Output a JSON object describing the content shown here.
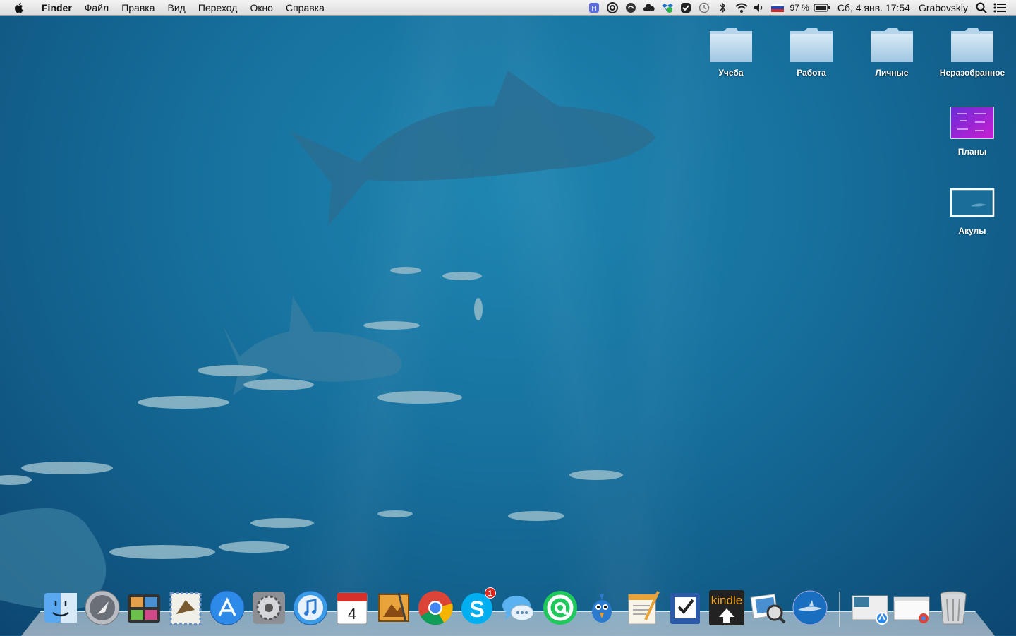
{
  "menubar": {
    "apple_icon": "apple-icon",
    "items": [
      "Finder",
      "Файл",
      "Правка",
      "Вид",
      "Переход",
      "Окно",
      "Справка"
    ],
    "status": {
      "battery_percent": "97 %",
      "datetime": "Сб, 4 янв.  17:54",
      "user": "Grabovskiy"
    }
  },
  "desktop": {
    "icons": [
      {
        "label": "Учеба",
        "icon": "folder-icon"
      },
      {
        "label": "Работа",
        "icon": "folder-icon"
      },
      {
        "label": "Личные",
        "icon": "folder-icon"
      },
      {
        "label": "Неразобранное",
        "icon": "folder-icon"
      },
      {
        "label": "Планы",
        "icon": "image-file-icon"
      },
      {
        "label": "Акулы",
        "icon": "image-file-icon"
      }
    ]
  },
  "dock": {
    "apps": [
      "finder-icon",
      "launchpad-icon",
      "photo-booth-icon",
      "mail-icon",
      "app-store-icon",
      "system-preferences-icon",
      "itunes-icon",
      "calendar-icon",
      "iphoto-icon",
      "chrome-icon",
      "skype-icon",
      "messages-icon",
      "mail-agent-icon",
      "twitterrific-icon",
      "pages-icon",
      "things-icon",
      "kindle-icon",
      "preview-icon",
      "shark-icon"
    ],
    "calendar_day": "4",
    "kindle_label": "kindle",
    "skype_badge": "1",
    "right": [
      "downloads-stack-icon",
      "documents-stack-icon",
      "trash-icon"
    ]
  }
}
